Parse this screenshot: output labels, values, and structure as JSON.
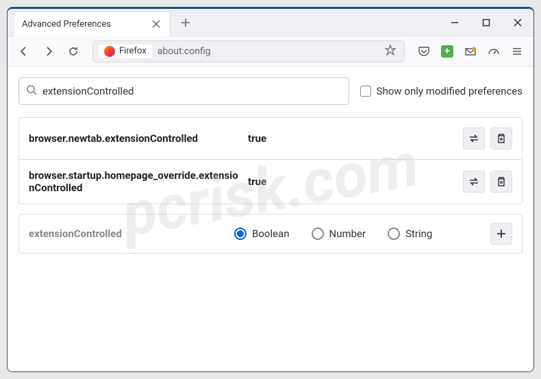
{
  "window": {
    "tab_title": "Advanced Preferences"
  },
  "urlbar": {
    "identity_label": "Firefox",
    "url": "about:config"
  },
  "search": {
    "value": "extensionControlled",
    "checkbox_label": "Show only modified preferences"
  },
  "prefs": [
    {
      "name": "browser.newtab.extensionControlled",
      "value": "true"
    },
    {
      "name": "browser.startup.homepage_override.extensionControlled",
      "value": "true"
    }
  ],
  "add_row": {
    "name": "extensionControlled",
    "types": [
      "Boolean",
      "Number",
      "String"
    ],
    "selected": "Boolean"
  },
  "watermark": "pcrisk.com"
}
